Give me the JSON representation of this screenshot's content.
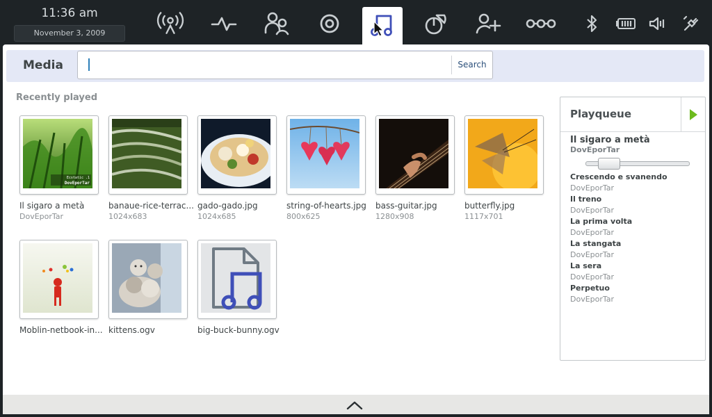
{
  "clock": {
    "time": "11:36 am",
    "date": "November  3, 2009"
  },
  "toolbar": {
    "icons": [
      "status-icon",
      "activity-icon",
      "people-icon",
      "internet-icon",
      "media-icon",
      "applications-icon",
      "pasteboard-icon",
      "devices-icon"
    ],
    "active": "media-icon",
    "status_icons": [
      "bluetooth-icon",
      "battery-icon",
      "volume-icon",
      "network-icon"
    ]
  },
  "header": {
    "title": "Media",
    "search_placeholder": "",
    "search_label": "Search"
  },
  "recent": {
    "title": "Recently played",
    "items": [
      {
        "title": "Il sigaro a metà",
        "sub": "DovEporTar"
      },
      {
        "title": "banaue-rice-terrac...",
        "sub": "1024x683"
      },
      {
        "title": "gado-gado.jpg",
        "sub": "1024x685"
      },
      {
        "title": "string-of-hearts.jpg",
        "sub": "800x625"
      },
      {
        "title": "bass-guitar.jpg",
        "sub": "1280x908"
      },
      {
        "title": "butterfly.jpg",
        "sub": "1117x701"
      },
      {
        "title": "Moblin-netbook-in...",
        "sub": ""
      },
      {
        "title": "kittens.ogv",
        "sub": ""
      },
      {
        "title": "big-buck-bunny.ogv",
        "sub": ""
      }
    ],
    "album_text_line1": "Ecstatic .1",
    "album_text_line2": "DovEporTar"
  },
  "playqueue": {
    "title": "Playqueue",
    "current": {
      "title": "Il sigaro a metà",
      "artist": "DovEporTar",
      "progress": 0.15
    },
    "items": [
      {
        "title": "Crescendo e svanendo",
        "artist": "DovEporTar"
      },
      {
        "title": "Il treno",
        "artist": "DovEporTar"
      },
      {
        "title": "La prima volta",
        "artist": "DovEporTar"
      },
      {
        "title": "La stangata",
        "artist": "DovEporTar"
      },
      {
        "title": "La sera",
        "artist": "DovEporTar"
      },
      {
        "title": "Perpetuo",
        "artist": "DovEporTar"
      }
    ]
  },
  "colors": {
    "accent": "#3f4fb8",
    "play": "#6dbb1e",
    "header_bg": "#e4e8f6"
  }
}
